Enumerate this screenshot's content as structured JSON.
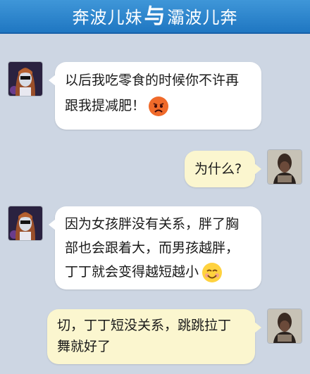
{
  "header": {
    "left_name": "奔波儿妹",
    "separator": "与",
    "right_name": "灞波儿奔"
  },
  "messages": [
    {
      "side": "left",
      "lines": [
        "以后我吃零食的时候你不许再",
        "跟我提减肥！"
      ],
      "emoji": "angry-face-icon"
    },
    {
      "side": "right",
      "lines": [
        "为什么?"
      ]
    },
    {
      "side": "left",
      "lines": [
        "因为女孩胖没有关系，胖了胸",
        "部也会跟着大，而男孩越胖，",
        "丁丁就会变得越短越小"
      ],
      "emoji": "smiling-face-icon"
    },
    {
      "side": "right",
      "lines": [
        "切，丁丁短没关系，跳跳拉丁",
        "舞就好了"
      ]
    }
  ],
  "colors": {
    "header_top": "#3f96d8",
    "header_bottom": "#1f77c2",
    "background": "#cdd6e3",
    "left_bubble": "#ffffff",
    "right_bubble": "#fbf6cf"
  }
}
